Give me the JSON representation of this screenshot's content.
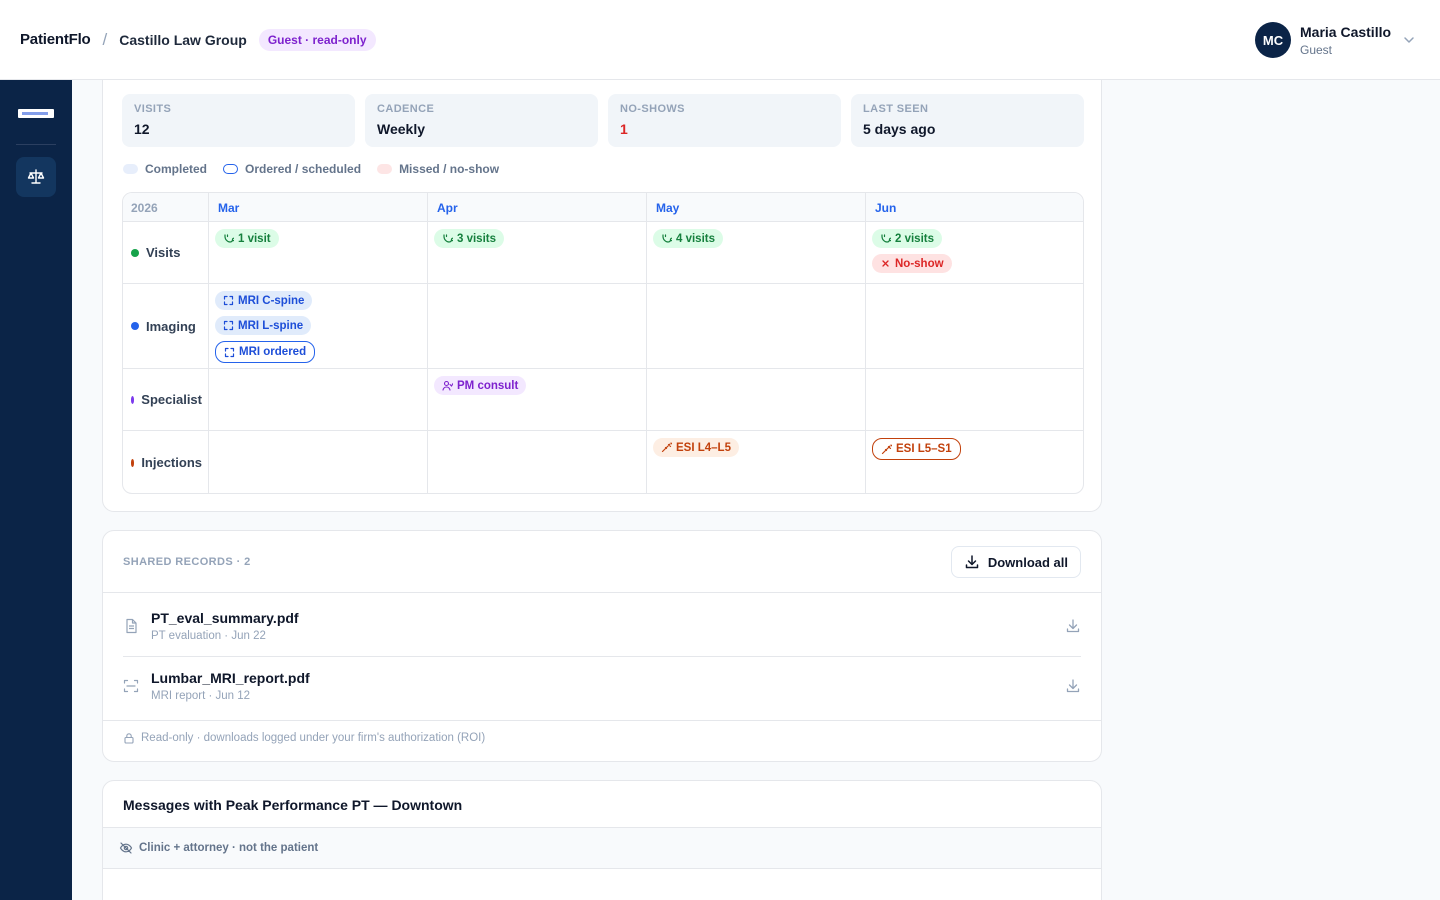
{
  "header": {
    "brand": "PatientFlo",
    "separator": "/",
    "firm": "Castillo Law Group",
    "access_badge": "Guest · read-only"
  },
  "user": {
    "initials": "MC",
    "name": "Maria Castillo",
    "role": "Guest"
  },
  "sidebar": {
    "items": [
      {
        "icon": "scale-icon",
        "active": true
      }
    ]
  },
  "stats": [
    {
      "label": "VISITS",
      "value": "12"
    },
    {
      "label": "CADENCE",
      "value": "Weekly"
    },
    {
      "label": "NO-SHOWS",
      "value": "1"
    },
    {
      "label": "LAST SEEN",
      "value": "5 days ago"
    }
  ],
  "legend": {
    "completed": "Completed",
    "ordered": "Ordered / scheduled",
    "missed": "Missed / no-show"
  },
  "timeline": {
    "year": "2026",
    "months": [
      "Mar",
      "Apr",
      "May",
      "Jun"
    ],
    "rows": [
      {
        "label": "Visits",
        "color": "#16a34a",
        "cells": [
          [
            {
              "text": "1 visit",
              "kind": "green",
              "icon": "visit-icon"
            }
          ],
          [
            {
              "text": "3 visits",
              "kind": "green",
              "icon": "visit-icon"
            }
          ],
          [
            {
              "text": "4 visits",
              "kind": "green",
              "icon": "visit-icon"
            }
          ],
          [
            {
              "text": "2 visits",
              "kind": "green",
              "icon": "visit-icon"
            },
            {
              "text": "No-show",
              "kind": "red",
              "icon": "x-icon"
            }
          ]
        ]
      },
      {
        "label": "Imaging",
        "color": "#2563eb",
        "cells": [
          [
            {
              "text": "MRI C-spine",
              "kind": "blue",
              "icon": "scan-icon"
            },
            {
              "text": "MRI L-spine",
              "kind": "blue",
              "icon": "scan-icon"
            },
            {
              "text": "MRI ordered",
              "kind": "blue-outline",
              "icon": "scan-icon"
            }
          ],
          [],
          [],
          []
        ]
      },
      {
        "label": "Specialist",
        "color": "#7c3aed",
        "cells": [
          [],
          [
            {
              "text": "PM consult",
              "kind": "purple",
              "icon": "person-icon"
            }
          ],
          [],
          []
        ]
      },
      {
        "label": "Injections",
        "color": "#c2410c",
        "cells": [
          [],
          [],
          [
            {
              "text": "ESI L4–L5",
              "kind": "orange",
              "icon": "syringe-icon"
            }
          ],
          [
            {
              "text": "ESI L5–S1",
              "kind": "orange-outline",
              "icon": "syringe-icon"
            }
          ]
        ]
      }
    ]
  },
  "records": {
    "title": "SHARED RECORDS · 2",
    "download_all": "Download all",
    "items": [
      {
        "name": "PT_eval_summary.pdf",
        "meta": "PT evaluation · Jun 22",
        "icon": "document-icon"
      },
      {
        "name": "Lumbar_MRI_report.pdf",
        "meta": "MRI report · Jun 12",
        "icon": "scan-icon"
      }
    ],
    "footer": "Read-only · downloads logged under your firm's authorization (ROI)"
  },
  "messages": {
    "title": "Messages with Peak Performance PT — Downtown",
    "visibility": "Clinic + attorney · not the patient"
  },
  "colors": {
    "navy": "#0b2447",
    "accent_blue": "#2563eb",
    "no_show_red": "#dc2626",
    "guest_purple": "#7e22ce"
  }
}
